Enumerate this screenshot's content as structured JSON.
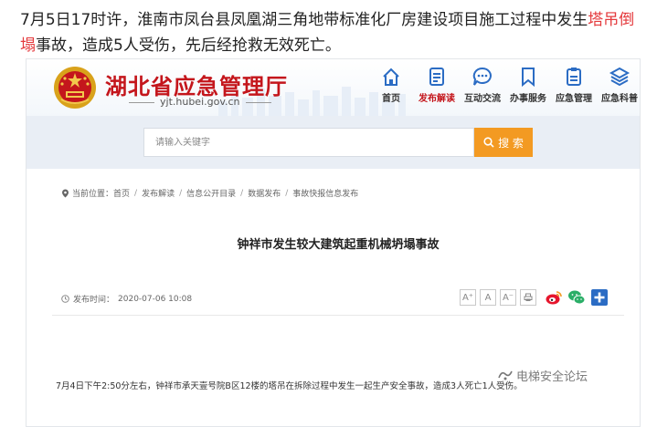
{
  "intro": {
    "part1": "7月5日17时许，淮南市凤台县凤凰湖三角地带标准化厂房建设项目施工过程中发生",
    "highlight": "塔吊倒塌",
    "part2": "事故，造成5人受伤，先后经抢救无效死亡。"
  },
  "site": {
    "title": "湖北省应急管理厅",
    "url": "yjt.hubei.gov.cn"
  },
  "nav": {
    "items": [
      {
        "label": "首页"
      },
      {
        "label": "发布解读"
      },
      {
        "label": "互动交流"
      },
      {
        "label": "办事服务"
      },
      {
        "label": "应急管理"
      },
      {
        "label": "应急科普"
      }
    ]
  },
  "search": {
    "placeholder": "请输入关键字",
    "button_label": "搜 索"
  },
  "breadcrumb": {
    "prefix": "当前位置：",
    "items": [
      "首页",
      "发布解读",
      "信息公开目录",
      "数据发布",
      "事故快报信息发布"
    ]
  },
  "article": {
    "title": "钟祥市发生较大建筑起重机械坍塌事故",
    "publish_label": "发布时间：",
    "publish_time": "2020-07-06 10:08",
    "font_large": "A⁺",
    "font_normal": "A",
    "font_small": "A⁻",
    "body_first_line": "7月4日下午2:50分左右，钟祥市承天壹号院B区12楼的塔吊在拆除过程中发生一起生产安全事故，造成3人死亡1人受伤。"
  },
  "watermark": {
    "text": "电梯安全论坛"
  },
  "colors": {
    "brand_red": "#c4161c",
    "highlight_red": "#e4393c",
    "search_orange": "#f39a22",
    "nav_blue": "#2b6cc4",
    "weibo": "#e6162d",
    "wechat": "#2aae67",
    "share_plus": "#2b6cc4"
  },
  "icons": {
    "nav": [
      "home-icon",
      "document-icon",
      "chat-icon",
      "bookmark-icon",
      "clipboard-icon",
      "layers-icon"
    ],
    "search": "search-icon",
    "share": [
      "weibo-icon",
      "wechat-icon",
      "plus-share-icon"
    ]
  }
}
